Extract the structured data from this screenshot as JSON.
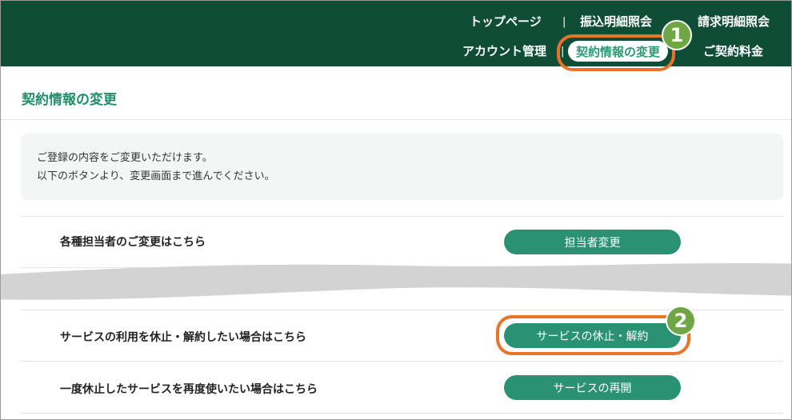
{
  "header": {
    "links_top": [
      "トップページ",
      "振込明細照会",
      "請求明細照会"
    ],
    "links_bottom": [
      "アカウント管理",
      "契約情報の変更",
      "ご契約料金"
    ],
    "separator": "|"
  },
  "callouts": {
    "first": "1",
    "second": "2"
  },
  "page": {
    "title": "契約情報の変更",
    "info_lines": [
      "ご登録の内容をご変更いただけます。",
      "以下のボタンより、変更画面まで進んでください。"
    ]
  },
  "rows": [
    {
      "label": "各種担当者のご変更はこちら",
      "button": "担当者変更"
    },
    {
      "label": "サービスの利用を休止・解約したい場合はこちら",
      "button": "サービスの休止・解約"
    },
    {
      "label": "一度休止したサービスを再度使いたい場合はこちら",
      "button": "サービスの再開"
    }
  ],
  "colors": {
    "header_bg": "#0f4d37",
    "accent_green": "#2a9272",
    "callout_orange": "#e8742a",
    "badge_green": "#6ea743"
  }
}
